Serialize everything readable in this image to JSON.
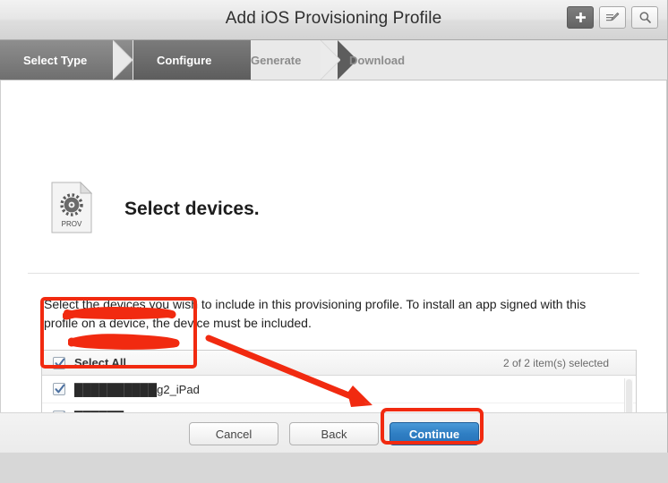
{
  "window": {
    "title": "Add iOS Provisioning Profile",
    "titlebar_buttons": [
      {
        "name": "add-button",
        "icon": "plus-icon",
        "label": "+"
      },
      {
        "name": "edit-button",
        "icon": "edit-pencil-icon",
        "label": ""
      },
      {
        "name": "search-button",
        "icon": "search-icon",
        "label": ""
      }
    ]
  },
  "steps": [
    {
      "label": "Select Type",
      "state": "completed"
    },
    {
      "label": "Configure",
      "state": "active"
    },
    {
      "label": "Generate",
      "state": "inactive"
    },
    {
      "label": "Download",
      "state": "inactive"
    }
  ],
  "page": {
    "icon_label": "PROV",
    "heading": "Select devices.",
    "instructions": "Select the devices you wish to include in this provisioning profile. To install an app signed with this profile on a device, the device must be included."
  },
  "device_list": {
    "select_all_label": "Select All",
    "select_all_checked": true,
    "count_label": "2 of 2 item(s) selected",
    "rows": [
      {
        "name": "██████████g2_iPad",
        "checked": true,
        "redacted": true
      },
      {
        "name": "██████ Ying_iPhone",
        "checked": true,
        "redacted": true
      }
    ]
  },
  "footer": {
    "cancel_label": "Cancel",
    "back_label": "Back",
    "continue_label": "Continue"
  },
  "annotations": {
    "highlight_color": "#f12a10",
    "device_box": "red rectangle around the two device rows",
    "continue_box": "red rectangle around the Continue button",
    "arrow": "red arrow pointing from device list to Continue button"
  },
  "colors": {
    "primary_button": "#2f7ec3",
    "annotation_red": "#f12a10",
    "active_step": "#6e6e6e"
  }
}
